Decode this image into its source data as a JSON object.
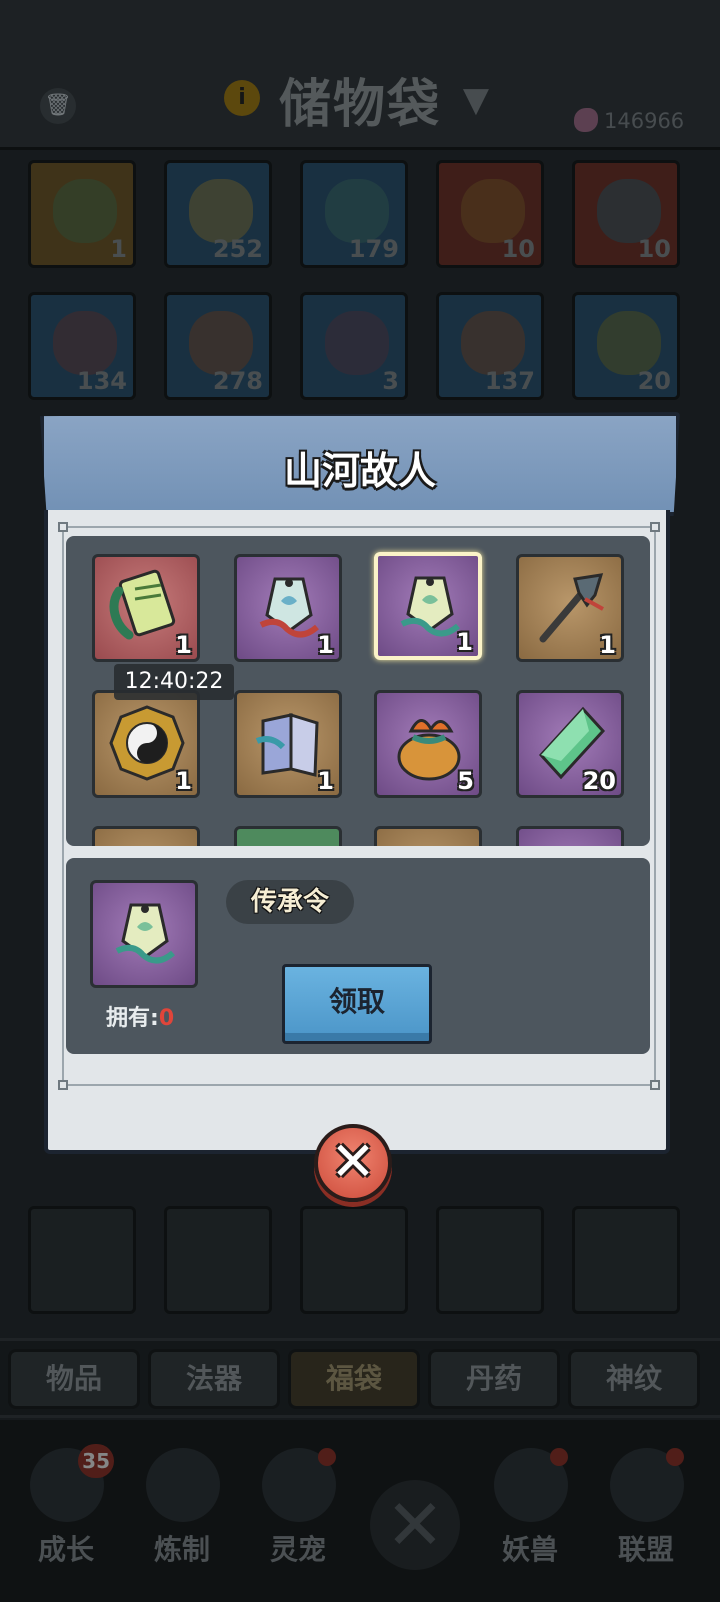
{
  "storage_bag": {
    "title": "储物袋",
    "currency_value": "146966",
    "slots_row1_counts": [
      "1",
      "252",
      "179",
      "10",
      "10"
    ],
    "slots_row2_counts": [
      "134",
      "278",
      "3",
      "137",
      "20"
    ]
  },
  "category_tabs": [
    "物品",
    "法器",
    "福袋",
    "丹药",
    "神纹"
  ],
  "active_category": "福袋",
  "bottom_nav": {
    "items": [
      {
        "label": "成长",
        "badge": "35"
      },
      {
        "label": "炼制"
      },
      {
        "label": "灵宠"
      },
      {
        "label": "妖兽"
      },
      {
        "label": "联盟"
      }
    ]
  },
  "dialog": {
    "title": "山河故人",
    "timer": "12:40:22",
    "rewards": [
      {
        "icon": "jade-slip-icon",
        "count": "1",
        "rarity": "red"
      },
      {
        "icon": "token-charm-icon",
        "count": "1",
        "rarity": "purple"
      },
      {
        "icon": "token-charm-icon",
        "count": "1",
        "rarity": "purple",
        "selected": true
      },
      {
        "icon": "dragon-staff-icon",
        "count": "1",
        "rarity": "gold"
      },
      {
        "icon": "yin-yang-medal-icon",
        "count": "1",
        "rarity": "gold"
      },
      {
        "icon": "scroll-book-icon",
        "count": "1",
        "rarity": "gold"
      },
      {
        "icon": "treasure-pouch-icon",
        "count": "5",
        "rarity": "purple"
      },
      {
        "icon": "green-crystal-icon",
        "count": "20",
        "rarity": "purple"
      }
    ],
    "selected_item": {
      "name": "传承令",
      "own_label": "拥有:",
      "own_value": "0"
    },
    "claim_label": "领取"
  },
  "colors": {
    "header_blue": "#7e9cc0",
    "claim_blue": "#5aa6d8",
    "close_red": "#e0604c",
    "own_red": "#e0453a"
  }
}
